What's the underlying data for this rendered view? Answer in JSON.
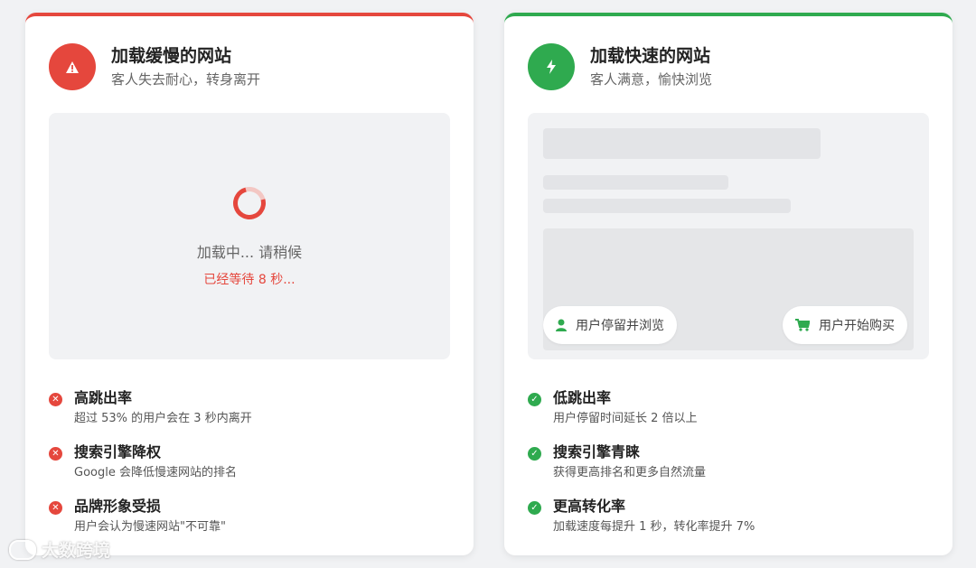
{
  "slow": {
    "title": "加载缓慢的网站",
    "subtitle": "客人失去耐心，转身离开",
    "icon": "warning-icon",
    "accent": "#e5473d",
    "loading_text": "加载中... 请稍候",
    "wait_text": "已经等待 8 秒...",
    "features": [
      {
        "title": "高跳出率",
        "desc": "超过 53% 的用户会在 3 秒内离开"
      },
      {
        "title": "搜索引擎降权",
        "desc": "Google 会降低慢速网站的排名"
      },
      {
        "title": "品牌形象受损",
        "desc": "用户会认为慢速网站\"不可靠\""
      }
    ]
  },
  "fast": {
    "title": "加载快速的网站",
    "subtitle": "客人满意，愉快浏览",
    "icon": "lightning-icon",
    "accent": "#2faa4f",
    "pill_user": "用户停留并浏览",
    "pill_cart": "用户开始购买",
    "features": [
      {
        "title": "低跳出率",
        "desc": "用户停留时间延长 2 倍以上"
      },
      {
        "title": "搜索引擎青睐",
        "desc": "获得更高排名和更多自然流量"
      },
      {
        "title": "更高转化率",
        "desc": "加载速度每提升 1 秒，转化率提升 7%"
      }
    ]
  },
  "watermark": "大数跨境"
}
